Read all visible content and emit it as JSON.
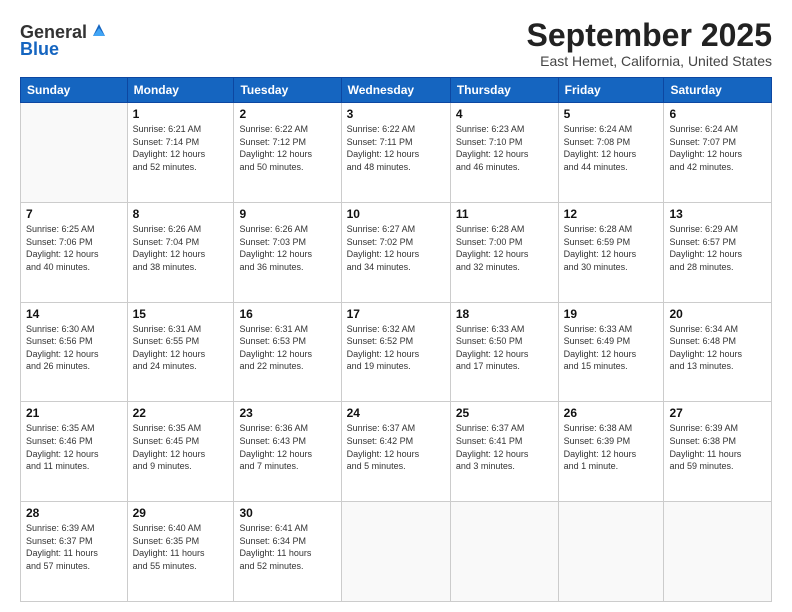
{
  "header": {
    "logo_line1": "General",
    "logo_line2": "Blue",
    "title": "September 2025",
    "subtitle": "East Hemet, California, United States"
  },
  "columns": [
    "Sunday",
    "Monday",
    "Tuesday",
    "Wednesday",
    "Thursday",
    "Friday",
    "Saturday"
  ],
  "weeks": [
    [
      {
        "day": "",
        "content": ""
      },
      {
        "day": "1",
        "content": "Sunrise: 6:21 AM\nSunset: 7:14 PM\nDaylight: 12 hours\nand 52 minutes."
      },
      {
        "day": "2",
        "content": "Sunrise: 6:22 AM\nSunset: 7:12 PM\nDaylight: 12 hours\nand 50 minutes."
      },
      {
        "day": "3",
        "content": "Sunrise: 6:22 AM\nSunset: 7:11 PM\nDaylight: 12 hours\nand 48 minutes."
      },
      {
        "day": "4",
        "content": "Sunrise: 6:23 AM\nSunset: 7:10 PM\nDaylight: 12 hours\nand 46 minutes."
      },
      {
        "day": "5",
        "content": "Sunrise: 6:24 AM\nSunset: 7:08 PM\nDaylight: 12 hours\nand 44 minutes."
      },
      {
        "day": "6",
        "content": "Sunrise: 6:24 AM\nSunset: 7:07 PM\nDaylight: 12 hours\nand 42 minutes."
      }
    ],
    [
      {
        "day": "7",
        "content": "Sunrise: 6:25 AM\nSunset: 7:06 PM\nDaylight: 12 hours\nand 40 minutes."
      },
      {
        "day": "8",
        "content": "Sunrise: 6:26 AM\nSunset: 7:04 PM\nDaylight: 12 hours\nand 38 minutes."
      },
      {
        "day": "9",
        "content": "Sunrise: 6:26 AM\nSunset: 7:03 PM\nDaylight: 12 hours\nand 36 minutes."
      },
      {
        "day": "10",
        "content": "Sunrise: 6:27 AM\nSunset: 7:02 PM\nDaylight: 12 hours\nand 34 minutes."
      },
      {
        "day": "11",
        "content": "Sunrise: 6:28 AM\nSunset: 7:00 PM\nDaylight: 12 hours\nand 32 minutes."
      },
      {
        "day": "12",
        "content": "Sunrise: 6:28 AM\nSunset: 6:59 PM\nDaylight: 12 hours\nand 30 minutes."
      },
      {
        "day": "13",
        "content": "Sunrise: 6:29 AM\nSunset: 6:57 PM\nDaylight: 12 hours\nand 28 minutes."
      }
    ],
    [
      {
        "day": "14",
        "content": "Sunrise: 6:30 AM\nSunset: 6:56 PM\nDaylight: 12 hours\nand 26 minutes."
      },
      {
        "day": "15",
        "content": "Sunrise: 6:31 AM\nSunset: 6:55 PM\nDaylight: 12 hours\nand 24 minutes."
      },
      {
        "day": "16",
        "content": "Sunrise: 6:31 AM\nSunset: 6:53 PM\nDaylight: 12 hours\nand 22 minutes."
      },
      {
        "day": "17",
        "content": "Sunrise: 6:32 AM\nSunset: 6:52 PM\nDaylight: 12 hours\nand 19 minutes."
      },
      {
        "day": "18",
        "content": "Sunrise: 6:33 AM\nSunset: 6:50 PM\nDaylight: 12 hours\nand 17 minutes."
      },
      {
        "day": "19",
        "content": "Sunrise: 6:33 AM\nSunset: 6:49 PM\nDaylight: 12 hours\nand 15 minutes."
      },
      {
        "day": "20",
        "content": "Sunrise: 6:34 AM\nSunset: 6:48 PM\nDaylight: 12 hours\nand 13 minutes."
      }
    ],
    [
      {
        "day": "21",
        "content": "Sunrise: 6:35 AM\nSunset: 6:46 PM\nDaylight: 12 hours\nand 11 minutes."
      },
      {
        "day": "22",
        "content": "Sunrise: 6:35 AM\nSunset: 6:45 PM\nDaylight: 12 hours\nand 9 minutes."
      },
      {
        "day": "23",
        "content": "Sunrise: 6:36 AM\nSunset: 6:43 PM\nDaylight: 12 hours\nand 7 minutes."
      },
      {
        "day": "24",
        "content": "Sunrise: 6:37 AM\nSunset: 6:42 PM\nDaylight: 12 hours\nand 5 minutes."
      },
      {
        "day": "25",
        "content": "Sunrise: 6:37 AM\nSunset: 6:41 PM\nDaylight: 12 hours\nand 3 minutes."
      },
      {
        "day": "26",
        "content": "Sunrise: 6:38 AM\nSunset: 6:39 PM\nDaylight: 12 hours\nand 1 minute."
      },
      {
        "day": "27",
        "content": "Sunrise: 6:39 AM\nSunset: 6:38 PM\nDaylight: 11 hours\nand 59 minutes."
      }
    ],
    [
      {
        "day": "28",
        "content": "Sunrise: 6:39 AM\nSunset: 6:37 PM\nDaylight: 11 hours\nand 57 minutes."
      },
      {
        "day": "29",
        "content": "Sunrise: 6:40 AM\nSunset: 6:35 PM\nDaylight: 11 hours\nand 55 minutes."
      },
      {
        "day": "30",
        "content": "Sunrise: 6:41 AM\nSunset: 6:34 PM\nDaylight: 11 hours\nand 52 minutes."
      },
      {
        "day": "",
        "content": ""
      },
      {
        "day": "",
        "content": ""
      },
      {
        "day": "",
        "content": ""
      },
      {
        "day": "",
        "content": ""
      }
    ]
  ]
}
